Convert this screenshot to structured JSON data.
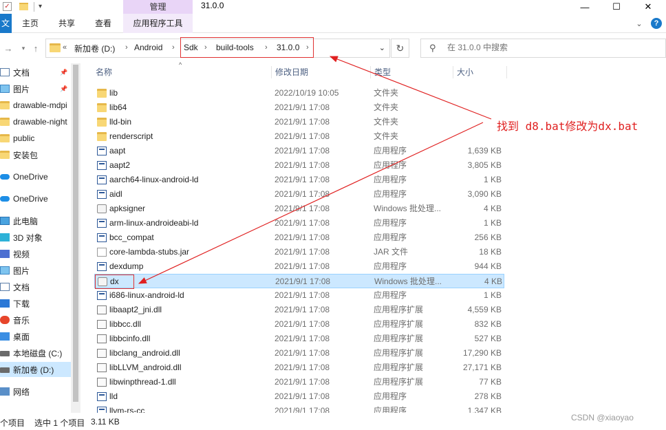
{
  "window": {
    "title": "31.0.0",
    "context_tab": "管理",
    "controls": {
      "minimize": "—",
      "maximize": "☐",
      "close": "✕"
    }
  },
  "ribbon": {
    "file_tab": "文",
    "tabs": [
      "主页",
      "共享",
      "查看"
    ],
    "context_tools": "应用程序工具",
    "collapse_glyph": "⌄",
    "help_glyph": "?"
  },
  "address": {
    "prefix": "«",
    "crumbs": [
      "新加卷 (D:)",
      "Android",
      "Sdk",
      "build-tools",
      "31.0.0"
    ],
    "separator": "›"
  },
  "search": {
    "placeholder": "在 31.0.0 中搜索"
  },
  "nav": {
    "items": [
      {
        "label": "文档",
        "icon": "document-icon",
        "pinned": true
      },
      {
        "label": "图片",
        "icon": "pictures-icon",
        "pinned": true
      },
      {
        "label": "drawable-mdpi",
        "icon": "folder-icon",
        "pinned": false
      },
      {
        "label": "drawable-night",
        "icon": "folder-icon",
        "pinned": false
      },
      {
        "label": "public",
        "icon": "folder-icon",
        "pinned": false
      },
      {
        "label": "安装包",
        "icon": "folder-icon",
        "pinned": false
      },
      {
        "label": "OneDrive",
        "icon": "onedrive-icon",
        "pinned": false
      },
      {
        "label": "OneDrive",
        "icon": "onedrive-icon",
        "pinned": false
      },
      {
        "label": "此电脑",
        "icon": "this-pc-icon",
        "pinned": false
      },
      {
        "label": "3D 对象",
        "icon": "3d-objects-icon",
        "pinned": false
      },
      {
        "label": "视频",
        "icon": "videos-icon",
        "pinned": false
      },
      {
        "label": "图片",
        "icon": "pictures-icon",
        "pinned": false
      },
      {
        "label": "文档",
        "icon": "document-icon",
        "pinned": false
      },
      {
        "label": "下载",
        "icon": "downloads-icon",
        "pinned": false
      },
      {
        "label": "音乐",
        "icon": "music-icon",
        "pinned": false
      },
      {
        "label": "桌面",
        "icon": "desktop-icon",
        "pinned": false
      },
      {
        "label": "本地磁盘 (C:)",
        "icon": "drive-icon",
        "pinned": false
      },
      {
        "label": "新加卷 (D:)",
        "icon": "drive-icon",
        "pinned": false,
        "selected": true
      },
      {
        "label": "网络",
        "icon": "network-icon",
        "pinned": false
      }
    ]
  },
  "columns": {
    "name": "名称",
    "date": "修改日期",
    "type": "类型",
    "size": "大小"
  },
  "files": [
    {
      "name": "lib",
      "date": "2022/10/19 10:05",
      "type": "文件夹",
      "size": "",
      "kind": "folder"
    },
    {
      "name": "lib64",
      "date": "2021/9/1 17:08",
      "type": "文件夹",
      "size": "",
      "kind": "folder"
    },
    {
      "name": "lld-bin",
      "date": "2021/9/1 17:08",
      "type": "文件夹",
      "size": "",
      "kind": "folder"
    },
    {
      "name": "renderscript",
      "date": "2021/9/1 17:08",
      "type": "文件夹",
      "size": "",
      "kind": "folder"
    },
    {
      "name": "aapt",
      "date": "2021/9/1 17:08",
      "type": "应用程序",
      "size": "1,639 KB",
      "kind": "exe"
    },
    {
      "name": "aapt2",
      "date": "2021/9/1 17:08",
      "type": "应用程序",
      "size": "3,805 KB",
      "kind": "exe"
    },
    {
      "name": "aarch64-linux-android-ld",
      "date": "2021/9/1 17:08",
      "type": "应用程序",
      "size": "1 KB",
      "kind": "exe"
    },
    {
      "name": "aidl",
      "date": "2021/9/1 17:08",
      "type": "应用程序",
      "size": "3,090 KB",
      "kind": "exe"
    },
    {
      "name": "apksigner",
      "date": "2021/9/1 17:08",
      "type": "Windows 批处理...",
      "size": "4 KB",
      "kind": "bat"
    },
    {
      "name": "arm-linux-androideabi-ld",
      "date": "2021/9/1 17:08",
      "type": "应用程序",
      "size": "1 KB",
      "kind": "exe"
    },
    {
      "name": "bcc_compat",
      "date": "2021/9/1 17:08",
      "type": "应用程序",
      "size": "256 KB",
      "kind": "exe"
    },
    {
      "name": "core-lambda-stubs.jar",
      "date": "2021/9/1 17:08",
      "type": "JAR 文件",
      "size": "18 KB",
      "kind": "jar"
    },
    {
      "name": "dexdump",
      "date": "2021/9/1 17:08",
      "type": "应用程序",
      "size": "944 KB",
      "kind": "exe"
    },
    {
      "name": "dx",
      "date": "2021/9/1 17:08",
      "type": "Windows 批处理...",
      "size": "4 KB",
      "kind": "bat",
      "selected": true
    },
    {
      "name": "i686-linux-android-ld",
      "date": "2021/9/1 17:08",
      "type": "应用程序",
      "size": "1 KB",
      "kind": "exe"
    },
    {
      "name": "libaapt2_jni.dll",
      "date": "2021/9/1 17:08",
      "type": "应用程序扩展",
      "size": "4,559 KB",
      "kind": "dll"
    },
    {
      "name": "libbcc.dll",
      "date": "2021/9/1 17:08",
      "type": "应用程序扩展",
      "size": "832 KB",
      "kind": "dll"
    },
    {
      "name": "libbcinfo.dll",
      "date": "2021/9/1 17:08",
      "type": "应用程序扩展",
      "size": "527 KB",
      "kind": "dll"
    },
    {
      "name": "libclang_android.dll",
      "date": "2021/9/1 17:08",
      "type": "应用程序扩展",
      "size": "17,290 KB",
      "kind": "dll"
    },
    {
      "name": "libLLVM_android.dll",
      "date": "2021/9/1 17:08",
      "type": "应用程序扩展",
      "size": "27,171 KB",
      "kind": "dll"
    },
    {
      "name": "libwinpthread-1.dll",
      "date": "2021/9/1 17:08",
      "type": "应用程序扩展",
      "size": "77 KB",
      "kind": "dll"
    },
    {
      "name": "lld",
      "date": "2021/9/1 17:08",
      "type": "应用程序",
      "size": "278 KB",
      "kind": "exe"
    },
    {
      "name": "llvm-rs-cc",
      "date": "2021/9/1 17:08",
      "type": "应用程序",
      "size": "1,347 KB",
      "kind": "exe"
    }
  ],
  "annotation": {
    "text": "找到 d8.bat修改为dx.bat",
    "color": "#e02020"
  },
  "status": {
    "count": "个项目",
    "selection": "选中 1 个项目",
    "size": "3.11 KB"
  },
  "watermark": "CSDN @xiaoyao",
  "colors": {
    "accent": "#1979ca",
    "selection": "#cce8ff",
    "context_tab": "#e9d5f7"
  }
}
